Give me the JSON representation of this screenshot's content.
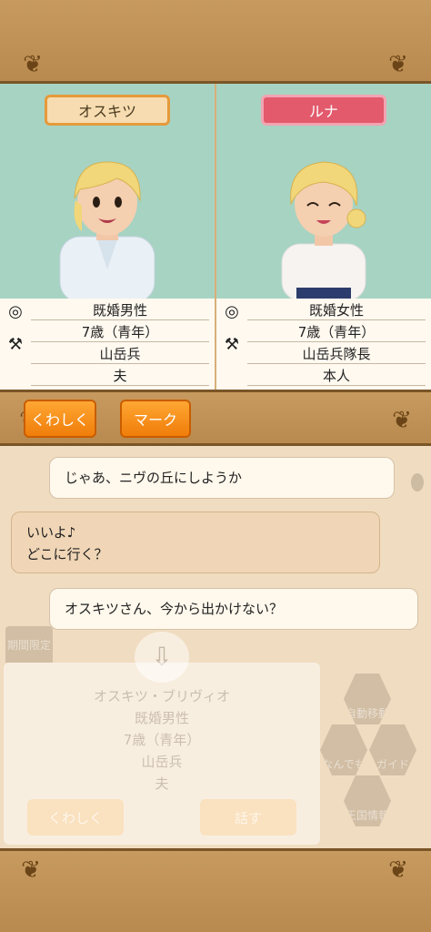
{
  "characters": [
    {
      "name": "オスキツ",
      "status": "既婚男性",
      "age": "7歳（青年）",
      "job": "山岳兵",
      "relation": "夫"
    },
    {
      "name": "ルナ",
      "status": "既婚女性",
      "age": "7歳（青年）",
      "job": "山岳兵隊長",
      "relation": "本人"
    }
  ],
  "icons": {
    "ring": "ring-icon",
    "axe": "axe-icon"
  },
  "buttons": {
    "details": "くわしく",
    "mark": "マーク"
  },
  "chat": [
    {
      "side": "right",
      "text": "じゃあ、ニヴの丘にしようか"
    },
    {
      "side": "left",
      "text": "いいよ♪\nどこに行く？"
    },
    {
      "side": "right",
      "text": "オスキツさん、今から出かけない？"
    }
  ],
  "background_card": {
    "badge": "期間限定",
    "name": "オスキツ・ブリヴィオ",
    "status": "既婚男性",
    "age": "7歳（青年）",
    "job": "山岳兵",
    "relation": "夫",
    "details_button": "くわしく",
    "talk_button": "話す"
  },
  "background_menu": {
    "items": [
      "自動移動",
      "なんでも",
      "ガイド",
      "王国情報"
    ]
  },
  "colors": {
    "wood": "#c79a5f",
    "panel_bg": "#a7d3c2",
    "accent_orange": "#f07d0a",
    "female_tag": "#e25a6c"
  }
}
